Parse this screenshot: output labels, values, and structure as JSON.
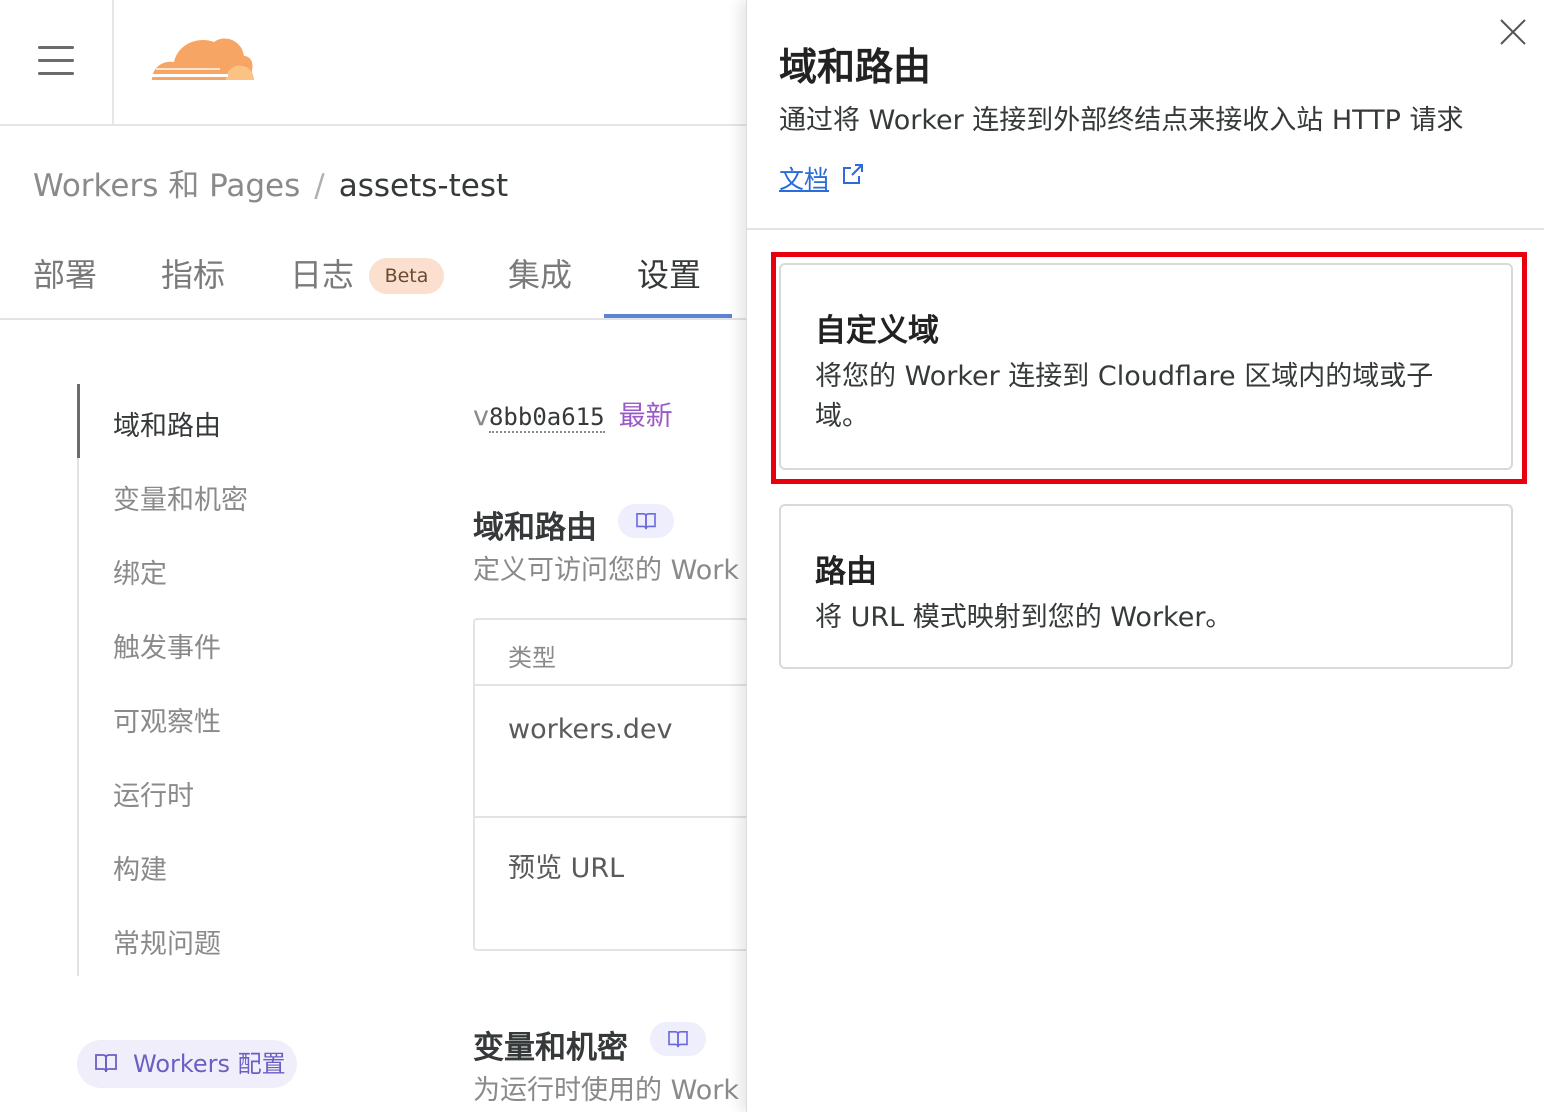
{
  "header": {
    "menu_icon": "hamburger-menu-icon",
    "logo_icon": "cloudflare-logo-icon"
  },
  "breadcrumb": {
    "parent": "Workers 和 Pages",
    "separator": "/",
    "current": "assets-test"
  },
  "tabs": [
    {
      "label": "部署"
    },
    {
      "label": "指标"
    },
    {
      "label": "日志",
      "badge": "Beta"
    },
    {
      "label": "集成"
    },
    {
      "label": "设置",
      "active": true
    }
  ],
  "sidenav": {
    "items": [
      {
        "label": "域和路由",
        "active": true
      },
      {
        "label": "变量和机密"
      },
      {
        "label": "绑定"
      },
      {
        "label": "触发事件"
      },
      {
        "label": "可观察性"
      },
      {
        "label": "运行时"
      },
      {
        "label": "构建"
      },
      {
        "label": "常规问题"
      }
    ],
    "config_link": "Workers 配置"
  },
  "main": {
    "version_prefix": "v",
    "version_hash": "8bb0a615",
    "version_tag": "最新",
    "domains_section": {
      "title": "域和路由",
      "subtitle": "定义可访问您的 Work"
    },
    "table": {
      "header": "类型",
      "rows": [
        "workers.dev",
        "预览 URL"
      ]
    },
    "vars_section": {
      "title": "变量和机密",
      "subtitle": "为运行时使用的 Work"
    }
  },
  "panel": {
    "title": "域和路由",
    "description": "通过将 Worker 连接到外部终结点来接收入站 HTTP 请求",
    "doc_link": "文档",
    "options": [
      {
        "title": "自定义域",
        "description": "将您的 Worker 连接到 Cloudflare 区域内的域或子域。",
        "highlighted": true
      },
      {
        "title": "路由",
        "description": "将 URL 模式映射到您的 Worker。"
      }
    ]
  },
  "colors": {
    "accent_tab_underline": "#5b84d6",
    "highlight_border": "#e8000f",
    "link_blue": "#2b6cd8",
    "latest_tag_purple": "#9b59c8",
    "beta_badge_bg": "#fbe0cf",
    "config_pill_bg": "#f1eefc"
  }
}
